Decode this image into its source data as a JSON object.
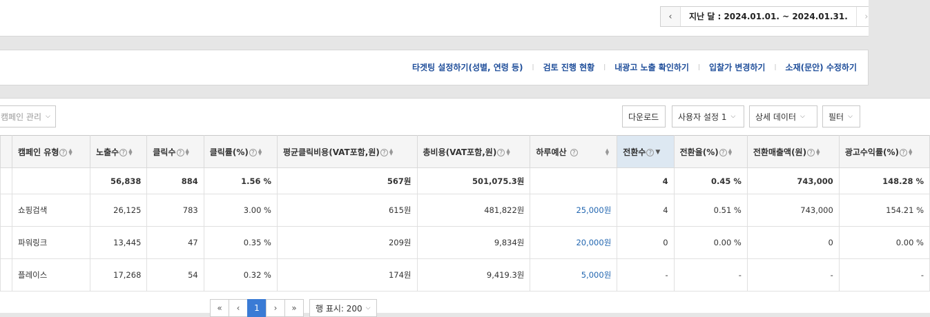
{
  "date_nav": {
    "label": "지난 달 : 2024.01.01. ~ 2024.01.31.",
    "prev_icon": "‹",
    "next_icon": "›"
  },
  "links": [
    "타겟팅 설정하기(성별, 연령 등)",
    "검토 진행 현황",
    "내광고 노출 확인하기",
    "입찰가 변경하기",
    "소재(문안) 수정하기"
  ],
  "link_separator": "|",
  "toolbar": {
    "campaign_manage": "캠페인 관리",
    "download": "다운로드",
    "user_setting": "사용자 설정 1",
    "detail_data": "상세 데이터",
    "filter": "필터"
  },
  "table": {
    "headers": [
      "캠페인 유형",
      "노출수",
      "클릭수",
      "클릭률(%)",
      "평균클릭비용(VAT포함,원)",
      "총비용(VAT포함,원)",
      "하루예산",
      "전환수",
      "전환율(%)",
      "전환매출액(원)",
      "광고수익률(%)"
    ],
    "total": [
      "",
      "56,838",
      "884",
      "1.56 %",
      "567원",
      "501,075.3원",
      "",
      "4",
      "0.45 %",
      "743,000",
      "148.28 %"
    ],
    "rows": [
      [
        "쇼핑검색",
        "26,125",
        "783",
        "3.00 %",
        "615원",
        "481,822원",
        "25,000원",
        "4",
        "0.51 %",
        "743,000",
        "154.21 %"
      ],
      [
        "파워링크",
        "13,445",
        "47",
        "0.35 %",
        "209원",
        "9,834원",
        "20,000원",
        "0",
        "0.00 %",
        "0",
        "0.00 %"
      ],
      [
        "플레이스",
        "17,268",
        "54",
        "0.32 %",
        "174원",
        "9,419.3원",
        "5,000원",
        "-",
        "-",
        "-",
        "-"
      ]
    ]
  },
  "pagination": {
    "first": "«",
    "prev": "‹",
    "current": "1",
    "next": "›",
    "last": "»",
    "rows_label": "행 표시: 200"
  },
  "colors": {
    "link": "#1f4e9a",
    "active_header": "#dde8f2",
    "current_page": "#3a7bd5"
  }
}
